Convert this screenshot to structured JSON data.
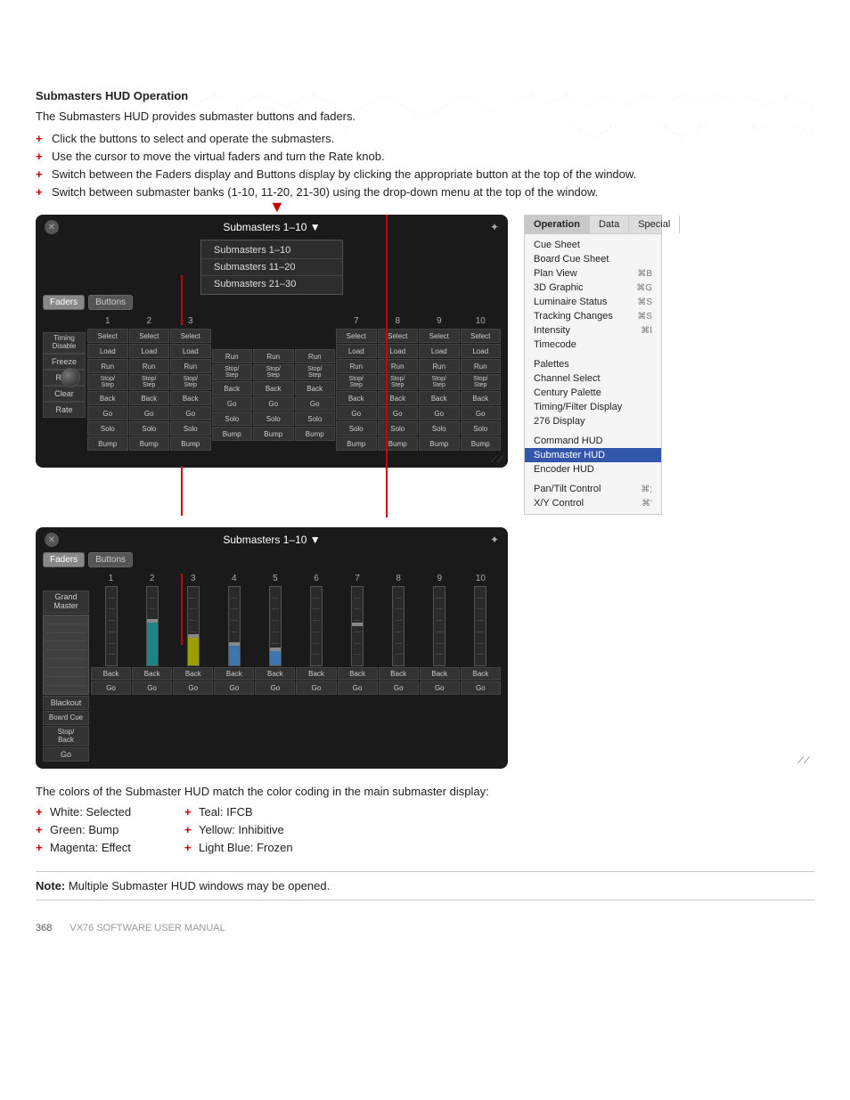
{
  "page": {
    "title": "Submasters HUD Operation",
    "intro": "The Submasters HUD provides submaster buttons and faders.",
    "bullets": [
      "Click the buttons to select and operate the submasters.",
      "Use the cursor to move the virtual faders and turn the Rate knob.",
      "Switch between the Faders display and Buttons display by clicking the appropriate button at the top of the window.",
      "Switch between submaster banks (1-10, 11-20, 21-30) using the drop-down menu at the top of the window."
    ]
  },
  "hud1": {
    "title": "Submasters 1–10 ▼",
    "tabs": [
      "Faders",
      "Buttons"
    ],
    "submenu": [
      "Submasters 1–10",
      "Submasters 11–20",
      "Submasters 21–30"
    ],
    "col_headers": [
      "1",
      "2",
      "3",
      "",
      "",
      "",
      "7",
      "8",
      "9",
      "10"
    ],
    "left_labels": [
      "Timing\nDisable",
      "Freeze",
      "Rate",
      "Clear",
      "Rate",
      "",
      "",
      ""
    ],
    "rows": {
      "select": "Select",
      "load": "Load",
      "run": "Run",
      "stop_step": "Stop/\nStep",
      "back": "Back",
      "go": "Go",
      "solo": "Solo",
      "bump": "Bump"
    }
  },
  "hud2": {
    "title": "Submasters 1–10 ▼",
    "tabs": [
      "Faders",
      "Buttons"
    ],
    "col_headers": [
      "1",
      "2",
      "3",
      "4",
      "5",
      "6",
      "7",
      "8",
      "9",
      "10"
    ],
    "left_labels": [
      "Grand\nMaster",
      "",
      "",
      "",
      "Blackout",
      "Board Cue"
    ],
    "rows": {
      "stop_back": "Stop/\nBack",
      "go": "Go"
    }
  },
  "right_menu": {
    "tabs": [
      "Operation",
      "Data",
      "Special"
    ],
    "active_tab": "Operation",
    "items": [
      {
        "label": "Cue Sheet",
        "shortcut": ""
      },
      {
        "label": "Board Cue Sheet",
        "shortcut": ""
      },
      {
        "label": "Plan View",
        "shortcut": "⌘B"
      },
      {
        "label": "3D Graphic",
        "shortcut": "⌘G"
      },
      {
        "label": "Luminaire Status",
        "shortcut": "⌘S"
      },
      {
        "label": "Tracking Changes",
        "shortcut": "⌘S"
      },
      {
        "label": "Intensity",
        "shortcut": "⌘I"
      },
      {
        "label": "Timecode",
        "shortcut": ""
      },
      {
        "label": "divider",
        "shortcut": ""
      },
      {
        "label": "Palettes",
        "shortcut": ""
      },
      {
        "label": "Channel Select",
        "shortcut": ""
      },
      {
        "label": "Century Palette",
        "shortcut": ""
      },
      {
        "label": "Timing/Filter Display",
        "shortcut": ""
      },
      {
        "label": "276 Display",
        "shortcut": ""
      },
      {
        "label": "divider2",
        "shortcut": ""
      },
      {
        "label": "Command HUD",
        "shortcut": ""
      },
      {
        "label": "Submaster HUD",
        "shortcut": "",
        "active": true
      },
      {
        "label": "Encoder HUD",
        "shortcut": ""
      },
      {
        "label": "divider3",
        "shortcut": ""
      },
      {
        "label": "Pan/Tilt Control",
        "shortcut": "⌘;"
      },
      {
        "label": "X/Y Control",
        "shortcut": "⌘'"
      }
    ]
  },
  "color_coding": {
    "intro": "The colors of the Submaster HUD match the color coding in the main submaster display:",
    "col1": [
      "White: Selected",
      "Green: Bump",
      "Magenta: Effect"
    ],
    "col2": [
      "Teal: IFCB",
      "Yellow: Inhibitive",
      "Light Blue: Frozen"
    ]
  },
  "note": {
    "label": "Note:",
    "text": "Multiple Submaster HUD windows may be opened."
  },
  "footer": {
    "page_num": "368",
    "manual": "VX76 SOFTWARE USER MANUAL"
  }
}
